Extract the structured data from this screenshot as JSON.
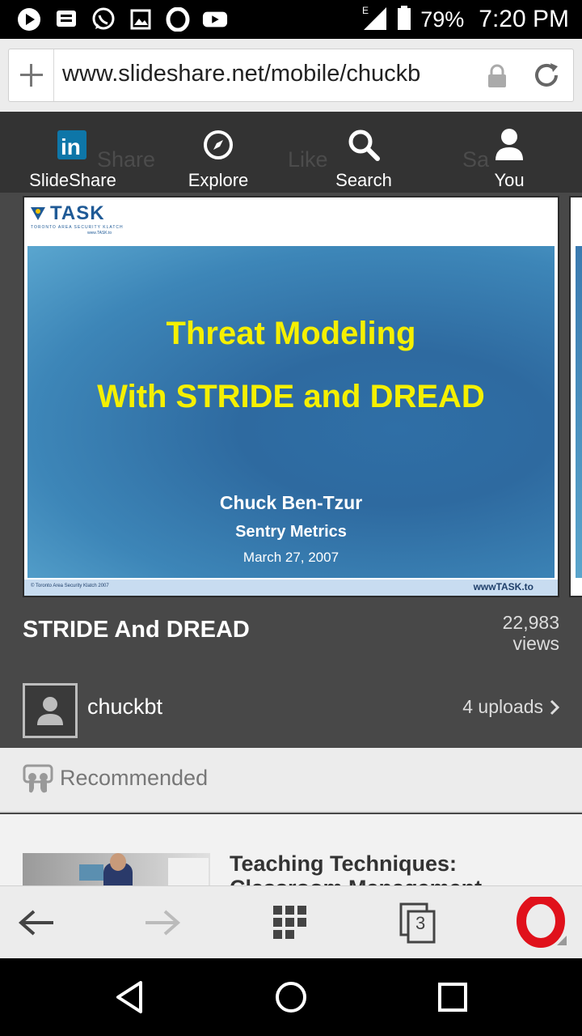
{
  "status_bar": {
    "network": "E",
    "battery": "79%",
    "time": "7:20 PM",
    "left_icons": [
      "play-store-icon",
      "message-icon",
      "whatsapp-icon",
      "gallery-icon",
      "opera-icon",
      "youtube-icon"
    ]
  },
  "address_bar": {
    "url": "www.slideshare.net/mobile/chuckb"
  },
  "top_nav": {
    "items": [
      {
        "label": "SlideShare",
        "icon": "linkedin-icon"
      },
      {
        "label": "Explore",
        "icon": "compass-icon"
      },
      {
        "label": "Search",
        "icon": "search-icon"
      },
      {
        "label": "You",
        "icon": "user-icon"
      }
    ],
    "ghost_labels": [
      "Share",
      "Like",
      "Sa"
    ]
  },
  "slide": {
    "logo": "TASK",
    "logo_sub": "TORONTO AREA SECURITY KLATCH",
    "logo_url": "www.TASK.to",
    "title_line1": "Threat Modeling",
    "title_line2": "With STRIDE and DREAD",
    "author": "Chuck Ben-Tzur",
    "company": "Sentry Metrics",
    "date": "March 27, 2007",
    "footer_copyright": "© Toronto Area Security Klatch 2007",
    "footer_url": "wwwTASK.to"
  },
  "document": {
    "title": "STRIDE And DREAD",
    "views_count": "22,983",
    "views_label": "views"
  },
  "author_row": {
    "username": "chuckbt",
    "uploads": "4 uploads"
  },
  "recommended": {
    "label": "Recommended",
    "items": [
      {
        "title": "Teaching Techniques: Classroom Management"
      }
    ]
  },
  "browser_toolbar": {
    "tab_count": "3"
  },
  "colors": {
    "page_bg": "#484848",
    "nav_bg": "#333333",
    "slide_title": "#f5f000",
    "opera_red": "#e0111b"
  }
}
